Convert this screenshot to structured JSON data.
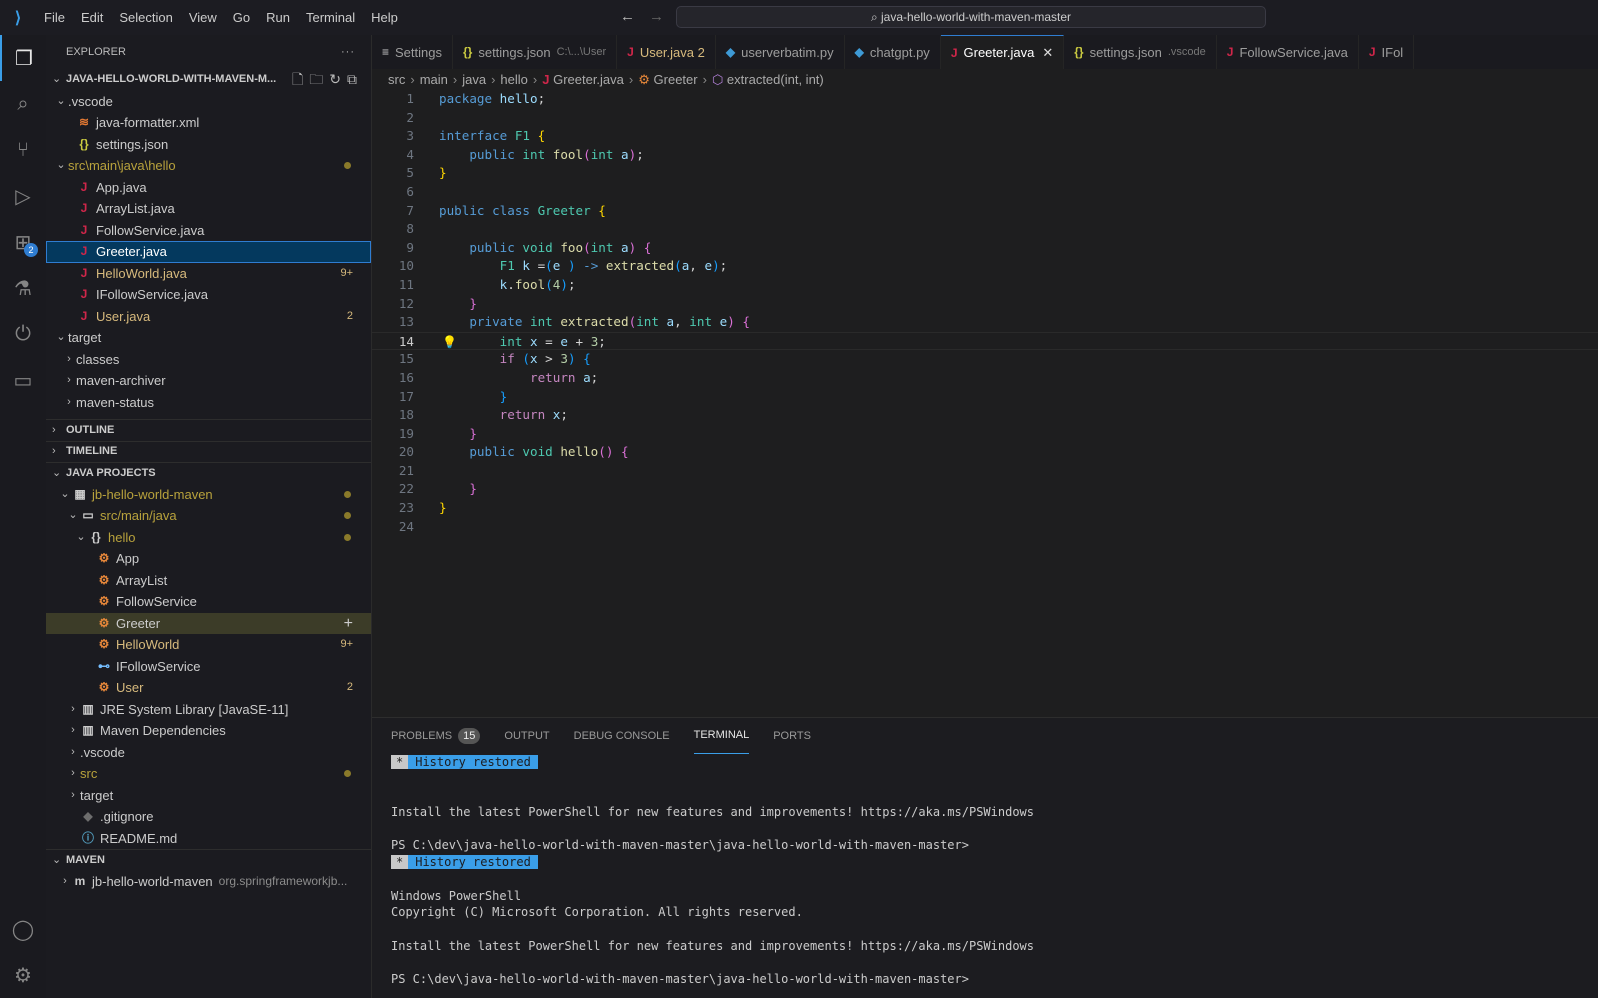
{
  "titlebar": {
    "menu": [
      "File",
      "Edit",
      "Selection",
      "View",
      "Go",
      "Run",
      "Terminal",
      "Help"
    ],
    "search": "java-hello-world-with-maven-master"
  },
  "activity": {
    "extensions_badge": "2"
  },
  "sidebar": {
    "title": "EXPLORER",
    "folder": "JAVA-HELLO-WORLD-WITH-MAVEN-M...",
    "explorer": [
      {
        "label": ".vscode",
        "depth": 1,
        "chev": "v",
        "color": "#ccc"
      },
      {
        "label": "java-formatter.xml",
        "depth": 2,
        "icon": "rss",
        "iconColor": "#e37933",
        "color": "#ccc"
      },
      {
        "label": "settings.json",
        "depth": 2,
        "icon": "{}",
        "iconColor": "#cbcb41",
        "color": "#ccc"
      },
      {
        "label": "src\\main\\java\\hello",
        "depth": 1,
        "chev": "v",
        "color": "#b8a23c",
        "dot": true
      },
      {
        "label": "App.java",
        "depth": 2,
        "icon": "J",
        "iconColor": "#d0264a",
        "color": "#ccc"
      },
      {
        "label": "ArrayList.java",
        "depth": 2,
        "icon": "J",
        "iconColor": "#d0264a",
        "color": "#ccc"
      },
      {
        "label": "FollowService.java",
        "depth": 2,
        "icon": "J",
        "iconColor": "#d0264a",
        "color": "#ccc"
      },
      {
        "label": "Greeter.java",
        "depth": 2,
        "icon": "J",
        "iconColor": "#d0264a",
        "color": "#fff",
        "selected": true
      },
      {
        "label": "HelloWorld.java",
        "depth": 2,
        "icon": "J",
        "iconColor": "#d0264a",
        "color": "#d7ba7d",
        "badge": "9+"
      },
      {
        "label": "IFollowService.java",
        "depth": 2,
        "icon": "J",
        "iconColor": "#d0264a",
        "color": "#ccc"
      },
      {
        "label": "User.java",
        "depth": 2,
        "icon": "J",
        "iconColor": "#d0264a",
        "color": "#d7ba7d",
        "badge": "2"
      },
      {
        "label": "target",
        "depth": 1,
        "chev": "v",
        "color": "#ccc"
      },
      {
        "label": "classes",
        "depth": 2,
        "chev": ">",
        "color": "#ccc"
      },
      {
        "label": "maven-archiver",
        "depth": 2,
        "chev": ">",
        "color": "#ccc"
      },
      {
        "label": "maven-status",
        "depth": 2,
        "chev": ">",
        "color": "#ccc"
      }
    ],
    "sections": {
      "outline": "OUTLINE",
      "timeline": "TIMELINE",
      "java_projects": "JAVA PROJECTS",
      "maven": "MAVEN"
    },
    "projects": [
      {
        "label": "jb-hello-world-maven",
        "depth": 1,
        "chev": "v",
        "icon": "▦",
        "iconColor": "#ccc",
        "color": "#b8a23c",
        "dot": true
      },
      {
        "label": "src/main/java",
        "depth": 2,
        "chev": "v",
        "icon": "▭",
        "iconColor": "#ccc",
        "color": "#b8a23c",
        "dot": true
      },
      {
        "label": "hello",
        "depth": 3,
        "chev": "v",
        "icon": "{}",
        "iconColor": "#ccc",
        "color": "#b8a23c",
        "dot": true
      },
      {
        "label": "App",
        "depth": 4,
        "icon": "⚙",
        "iconColor": "#e8883a",
        "color": "#ccc"
      },
      {
        "label": "ArrayList",
        "depth": 4,
        "icon": "⚙",
        "iconColor": "#e8883a",
        "color": "#ccc"
      },
      {
        "label": "FollowService",
        "depth": 4,
        "icon": "⚙",
        "iconColor": "#e8883a",
        "color": "#ccc"
      },
      {
        "label": "Greeter",
        "depth": 4,
        "icon": "⚙",
        "iconColor": "#e8883a",
        "color": "#ccc",
        "hover": true,
        "plus": "+"
      },
      {
        "label": "HelloWorld",
        "depth": 4,
        "icon": "⚙",
        "iconColor": "#e8883a",
        "color": "#d7ba7d",
        "badge": "9+"
      },
      {
        "label": "IFollowService",
        "depth": 4,
        "icon": "⊷",
        "iconColor": "#75beff",
        "color": "#ccc"
      },
      {
        "label": "User",
        "depth": 4,
        "icon": "⚙",
        "iconColor": "#e8883a",
        "color": "#d7ba7d",
        "badge": "2"
      },
      {
        "label": "JRE System Library [JavaSE-11]",
        "depth": 2,
        "chev": ">",
        "icon": "▥",
        "iconColor": "#ccc",
        "color": "#ccc"
      },
      {
        "label": "Maven Dependencies",
        "depth": 2,
        "chev": ">",
        "icon": "▥",
        "iconColor": "#ccc",
        "color": "#ccc"
      },
      {
        "label": ".vscode",
        "depth": 2,
        "chev": ">",
        "color": "#ccc"
      },
      {
        "label": "src",
        "depth": 2,
        "chev": ">",
        "color": "#b8a23c",
        "dot": true
      },
      {
        "label": "target",
        "depth": 2,
        "chev": ">",
        "color": "#ccc"
      },
      {
        "label": ".gitignore",
        "depth": 2,
        "icon": "◆",
        "iconColor": "#6d6d6d",
        "color": "#ccc"
      },
      {
        "label": "README.md",
        "depth": 2,
        "icon": "ⓘ",
        "iconColor": "#519aba",
        "color": "#ccc"
      }
    ],
    "maven": [
      {
        "label": "jb-hello-world-maven",
        "depth": 1,
        "chev": ">",
        "icon": "m",
        "iconColor": "#ccc",
        "color": "#ccc",
        "desc": "org.springframeworkjb..."
      }
    ]
  },
  "tabs": [
    {
      "label": "Settings",
      "icon": "≡",
      "iconColor": "#ccc"
    },
    {
      "label": "settings.json",
      "icon": "{}",
      "iconColor": "#cbcb41",
      "desc": "C:\\...\\User"
    },
    {
      "label": "User.java 2",
      "icon": "J",
      "iconColor": "#d0264a",
      "color": "#d7ba7d"
    },
    {
      "label": "userverbatim.py",
      "icon": "◆",
      "iconColor": "#3e9ad6"
    },
    {
      "label": "chatgpt.py",
      "icon": "◆",
      "iconColor": "#3e9ad6"
    },
    {
      "label": "Greeter.java",
      "icon": "J",
      "iconColor": "#d0264a",
      "active": true,
      "close": "✕"
    },
    {
      "label": "settings.json",
      "icon": "{}",
      "iconColor": "#cbcb41",
      "desc": ".vscode"
    },
    {
      "label": "FollowService.java",
      "icon": "J",
      "iconColor": "#d0264a"
    },
    {
      "label": "IFol",
      "icon": "J",
      "iconColor": "#d0264a"
    }
  ],
  "breadcrumb": [
    "src",
    "main",
    "java",
    "hello",
    "Greeter.java",
    "Greeter",
    "extracted(int, int)"
  ],
  "editor": {
    "current_line": 14,
    "lines": [
      [
        [
          "package ",
          "kw"
        ],
        [
          "hello",
          "va"
        ],
        [
          ";",
          "pl"
        ]
      ],
      [],
      [
        [
          "interface ",
          "kw"
        ],
        [
          "F1 ",
          "ty"
        ],
        [
          "{",
          "b1"
        ]
      ],
      [
        [
          "    public ",
          "kw"
        ],
        [
          "int ",
          "ty"
        ],
        [
          "fool",
          "fn"
        ],
        [
          "(",
          "b2"
        ],
        [
          "int ",
          "ty"
        ],
        [
          "a",
          "va"
        ],
        [
          ")",
          "b2"
        ],
        [
          ";",
          "pl"
        ]
      ],
      [
        [
          "}",
          "b1"
        ]
      ],
      [],
      [
        [
          "public ",
          "kw"
        ],
        [
          "class ",
          "kw"
        ],
        [
          "Greeter ",
          "ty"
        ],
        [
          "{",
          "b1"
        ]
      ],
      [],
      [
        [
          "    public ",
          "kw"
        ],
        [
          "void ",
          "ty"
        ],
        [
          "foo",
          "fn"
        ],
        [
          "(",
          "b2"
        ],
        [
          "int ",
          "ty"
        ],
        [
          "a",
          "va"
        ],
        [
          ") ",
          "b2"
        ],
        [
          "{",
          "b2"
        ]
      ],
      [
        [
          "        F1 ",
          "ty"
        ],
        [
          "k ",
          "va"
        ],
        [
          "=",
          "pl"
        ],
        [
          "(",
          "b3"
        ],
        [
          "e ",
          "va"
        ],
        [
          ") ",
          "b3"
        ],
        [
          "-> ",
          "kw"
        ],
        [
          "extracted",
          "fn"
        ],
        [
          "(",
          "b3"
        ],
        [
          "a",
          "va"
        ],
        [
          ", ",
          "pl"
        ],
        [
          "e",
          "va"
        ],
        [
          ")",
          "b3"
        ],
        [
          ";",
          "pl"
        ]
      ],
      [
        [
          "        k",
          "va"
        ],
        [
          ".",
          "pl"
        ],
        [
          "fool",
          "fn"
        ],
        [
          "(",
          "b3"
        ],
        [
          "4",
          "nu"
        ],
        [
          ")",
          "b3"
        ],
        [
          ";",
          "pl"
        ]
      ],
      [
        [
          "    }",
          "b2"
        ]
      ],
      [
        [
          "    private ",
          "kw"
        ],
        [
          "int ",
          "ty"
        ],
        [
          "extracted",
          "fn"
        ],
        [
          "(",
          "b2"
        ],
        [
          "int ",
          "ty"
        ],
        [
          "a",
          "va"
        ],
        [
          ", ",
          "pl"
        ],
        [
          "int ",
          "ty"
        ],
        [
          "e",
          "va"
        ],
        [
          ") ",
          "b2"
        ],
        [
          "{",
          "b2"
        ]
      ],
      [
        [
          "        int ",
          "ty"
        ],
        [
          "x ",
          "va"
        ],
        [
          "= ",
          "pl"
        ],
        [
          "e ",
          "va"
        ],
        [
          "+ ",
          "pl"
        ],
        [
          "3",
          "nu"
        ],
        [
          ";",
          "pl"
        ]
      ],
      [
        [
          "        if ",
          "ct"
        ],
        [
          "(",
          "b3"
        ],
        [
          "x ",
          "va"
        ],
        [
          "> ",
          "pl"
        ],
        [
          "3",
          "nu"
        ],
        [
          ") ",
          "b3"
        ],
        [
          "{",
          "b3"
        ]
      ],
      [
        [
          "            return ",
          "ct"
        ],
        [
          "a",
          "va"
        ],
        [
          ";",
          "pl"
        ]
      ],
      [
        [
          "        }",
          "b3"
        ]
      ],
      [
        [
          "        return ",
          "ct"
        ],
        [
          "x",
          "va"
        ],
        [
          ";",
          "pl"
        ]
      ],
      [
        [
          "    }",
          "b2"
        ]
      ],
      [
        [
          "    public ",
          "kw"
        ],
        [
          "void ",
          "ty"
        ],
        [
          "hello",
          "fn"
        ],
        [
          "() ",
          "b2"
        ],
        [
          "{",
          "b2"
        ]
      ],
      [],
      [
        [
          "    }",
          "b2"
        ]
      ],
      [
        [
          "}",
          "b1"
        ]
      ],
      []
    ]
  },
  "panel": {
    "tabs": [
      "PROBLEMS",
      "OUTPUT",
      "DEBUG CONSOLE",
      "TERMINAL",
      "PORTS"
    ],
    "problems_count": "15",
    "active": "TERMINAL",
    "terminal": [
      {
        "hist": true,
        "star": "*",
        "label": "History restored"
      },
      {
        "text": ""
      },
      {
        "text": ""
      },
      {
        "text": "Install the latest PowerShell for new features and improvements! https://aka.ms/PSWindows"
      },
      {
        "text": ""
      },
      {
        "text": "PS C:\\dev\\java-hello-world-with-maven-master\\java-hello-world-with-maven-master>"
      },
      {
        "hist": true,
        "star": "*",
        "label": "History restored"
      },
      {
        "text": ""
      },
      {
        "text": "Windows PowerShell"
      },
      {
        "text": "Copyright (C) Microsoft Corporation. All rights reserved."
      },
      {
        "text": ""
      },
      {
        "text": "Install the latest PowerShell for new features and improvements! https://aka.ms/PSWindows"
      },
      {
        "text": ""
      },
      {
        "text": "PS C:\\dev\\java-hello-world-with-maven-master\\java-hello-world-with-maven-master>"
      }
    ]
  }
}
